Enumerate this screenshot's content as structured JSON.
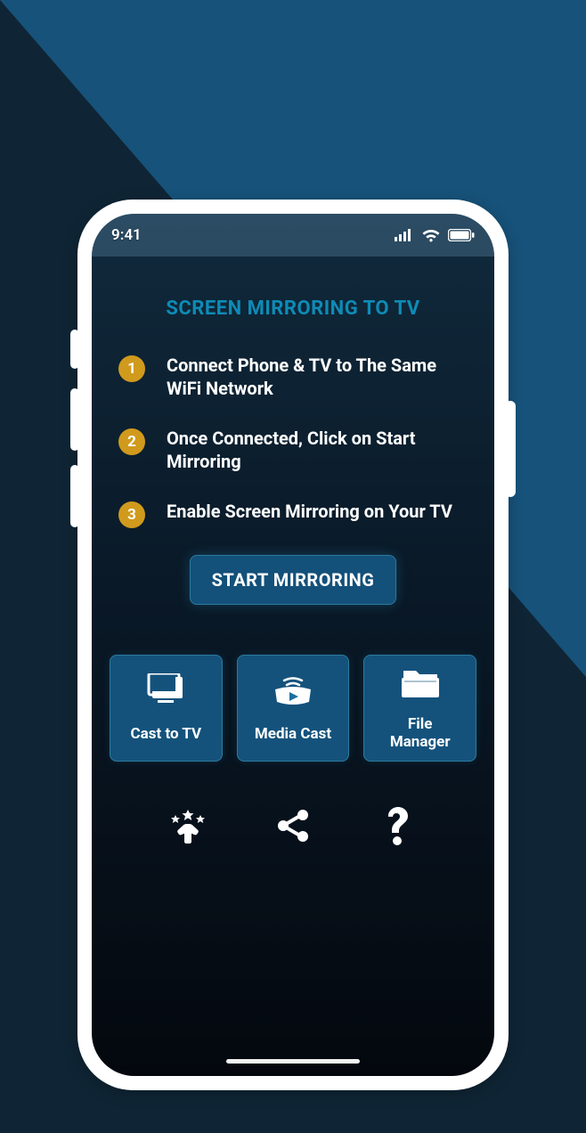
{
  "status": {
    "time": "9:41"
  },
  "title": "SCREEN MIRRORING TO TV",
  "steps": [
    {
      "num": "1",
      "text": "Connect Phone & TV to The Same WiFi Network"
    },
    {
      "num": "2",
      "text": "Once Connected, Click on Start Mirroring"
    },
    {
      "num": "3",
      "text": "Enable Screen Mirroring on Your TV"
    }
  ],
  "start_label": "START MIRRORING",
  "tiles": {
    "cast": "Cast to TV",
    "media": "Media Cast",
    "file": "File\nManager"
  }
}
